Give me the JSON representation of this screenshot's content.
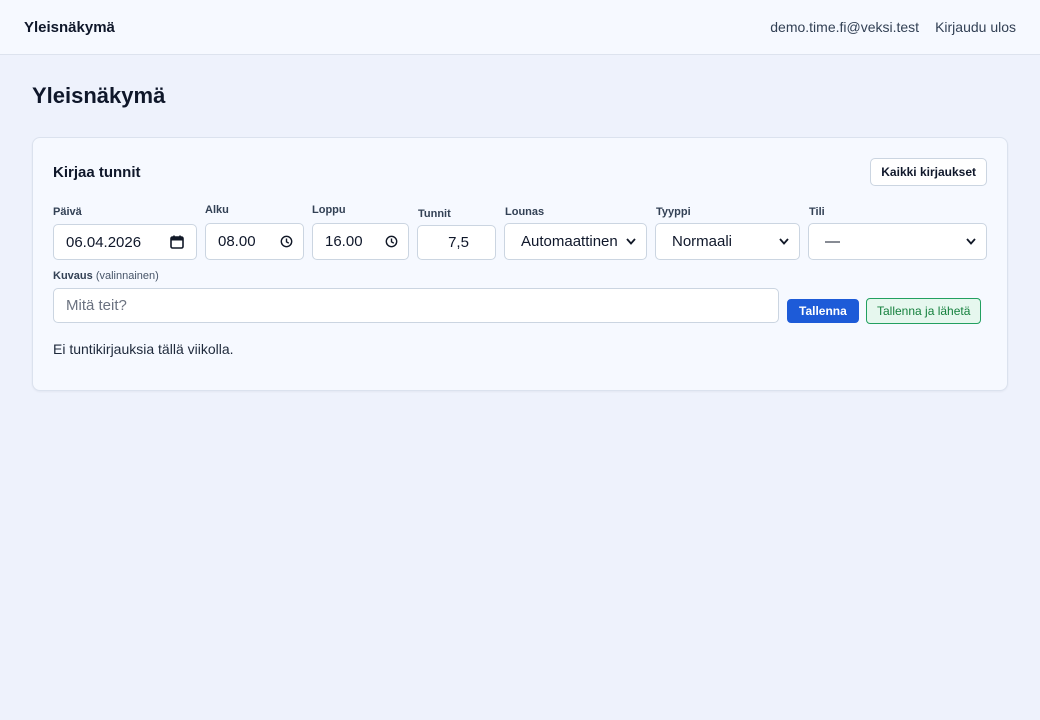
{
  "header": {
    "brand": "Yleisnäkymä",
    "user_email": "demo.time.fi@veksi.test",
    "logout_label": "Kirjaudu ulos"
  },
  "page": {
    "title": "Yleisnäkymä"
  },
  "card": {
    "title": "Kirjaa tunnit",
    "all_entries_label": "Kaikki kirjaukset",
    "fields": {
      "date": {
        "label": "Päivä",
        "value": "06.04.2026"
      },
      "start": {
        "label": "Alku",
        "value": "08.00"
      },
      "end": {
        "label": "Loppu",
        "value": "16.00"
      },
      "hours": {
        "label": "Tunnit",
        "value": "7,5"
      },
      "lunch": {
        "label": "Lounas",
        "value": "Automaattinen"
      },
      "type": {
        "label": "Tyyppi",
        "value": "Normaali"
      },
      "account": {
        "label": "Tili",
        "value": "—"
      }
    },
    "description": {
      "label": "Kuvaus",
      "optional": "(valinnainen)",
      "placeholder": "Mitä teit?"
    },
    "save_label": "Tallenna",
    "save_send_label": "Tallenna ja lähetä",
    "empty_message": "Ei tuntikirjauksia tällä viikolla."
  },
  "colors": {
    "accent": "#1d5bd8",
    "success": "#15803d",
    "background": "#eef2fc"
  },
  "icons": {
    "calendar": "calendar-icon",
    "clock": "clock-icon",
    "chevron": "chevron-down-icon"
  }
}
